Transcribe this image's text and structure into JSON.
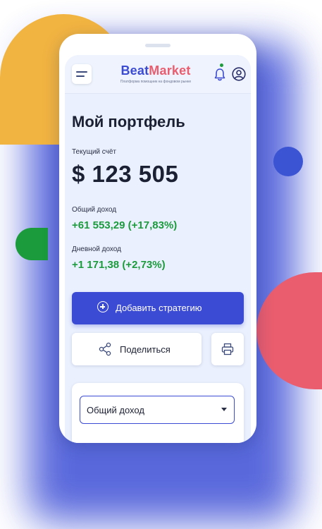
{
  "brand": {
    "name_part1": "Beat",
    "name_part2": "Market",
    "tagline": "Платформа помощник на фондовом рынке",
    "accent": "#3c4bd3",
    "secondary": "#e95d6f"
  },
  "header": {
    "menu_icon": "hamburger-icon",
    "notification_icon": "bell-icon",
    "profile_icon": "user-icon"
  },
  "portfolio": {
    "title": "Мой портфель",
    "account_label": "Текущий счёт",
    "account_value": "$ 123 505",
    "total_income_label": "Общий доход",
    "total_income_value": "+61 553,29 (+17,83%)",
    "daily_income_label": "Дневной доход",
    "daily_income_value": "+1 171,38 (+2,73%)",
    "gain_color": "#1b9b3c"
  },
  "actions": {
    "add_strategy": "Добавить стратегию",
    "share": "Поделиться",
    "print_icon": "printer-icon",
    "share_icon": "share-icon"
  },
  "chart_filter": {
    "selected": "Общий доход"
  }
}
